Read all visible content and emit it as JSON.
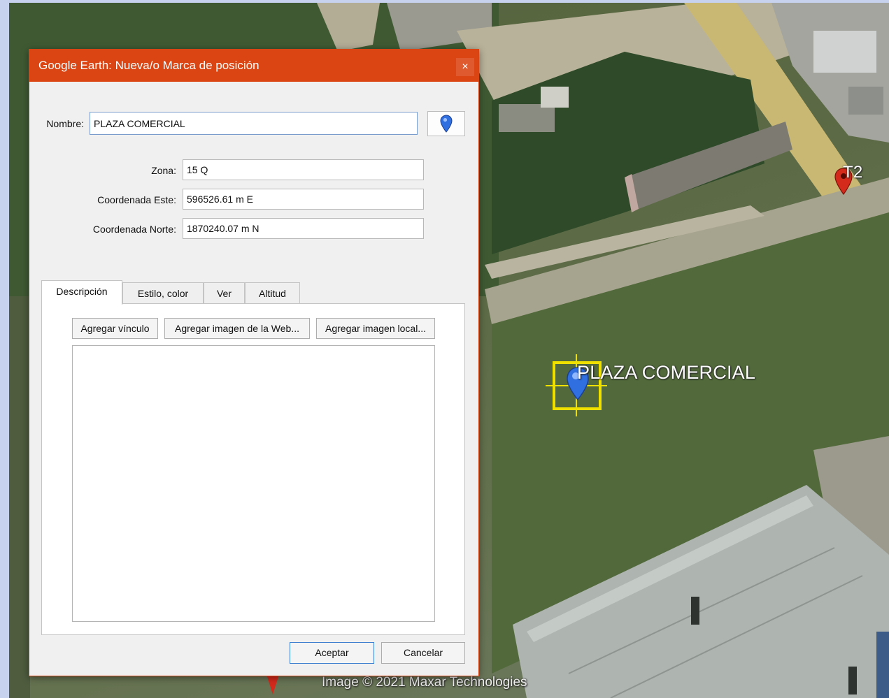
{
  "dialog": {
    "title": "Google Earth: Nueva/o Marca de posición",
    "close_label": "×",
    "name_label": "Nombre:",
    "name_value": "PLAZA COMERCIAL",
    "zone_label": "Zona:",
    "zone_value": "15 Q",
    "east_label": "Coordenada Este:",
    "east_value": "596526.61 m E",
    "north_label": "Coordenada Norte:",
    "north_value": "1870240.07 m N",
    "tabs": [
      {
        "label": "Descripción",
        "active": true
      },
      {
        "label": "Estilo, color",
        "active": false
      },
      {
        "label": "Ver",
        "active": false
      },
      {
        "label": "Altitud",
        "active": false
      }
    ],
    "add_link_label": "Agregar vínculo",
    "add_web_image_label": "Agregar imagen de la Web...",
    "add_local_image_label": "Agregar imagen local...",
    "description_value": "",
    "ok_label": "Aceptar",
    "cancel_label": "Cancelar"
  },
  "map": {
    "placemark_label": "PLAZA COMERCIAL",
    "marker_label": "T2",
    "imagery_credit": "Image © 2021 Maxar Technologies",
    "placemark_icon": "blue-pin-icon",
    "marker_icon": "red-pin-icon",
    "selection_color": "#f0e000"
  },
  "colors": {
    "titlebar": "#da4513",
    "desktop": "#c7d3ee"
  }
}
